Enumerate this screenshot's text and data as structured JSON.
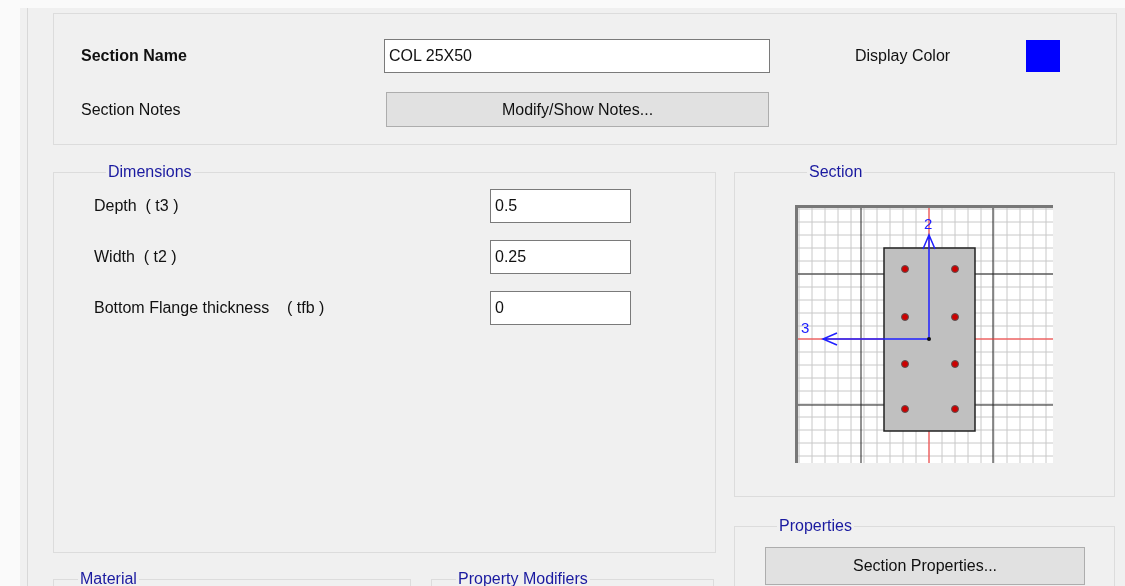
{
  "section_name": {
    "label": "Section Name",
    "value": "COL 25X50"
  },
  "section_notes": {
    "label": "Section Notes",
    "button": "Modify/Show Notes..."
  },
  "display_color": {
    "label": "Display Color",
    "color": "#0000ff"
  },
  "dimensions": {
    "title": "Dimensions",
    "fields": [
      {
        "label": "Depth  ( t3 )",
        "value": "0.5"
      },
      {
        "label": "Width  ( t2 )",
        "value": "0.25"
      }
    ],
    "bottom_field": {
      "label": "Bottom Flange thickness    ( tfb )",
      "value": "0"
    }
  },
  "section": {
    "title": "Section",
    "axis_labels": [
      "2",
      "3"
    ]
  },
  "properties": {
    "title": "Properties",
    "button": "Section Properties..."
  },
  "material": {
    "title": "Material"
  },
  "property_modifiers": {
    "title": "Property Modifiers"
  }
}
